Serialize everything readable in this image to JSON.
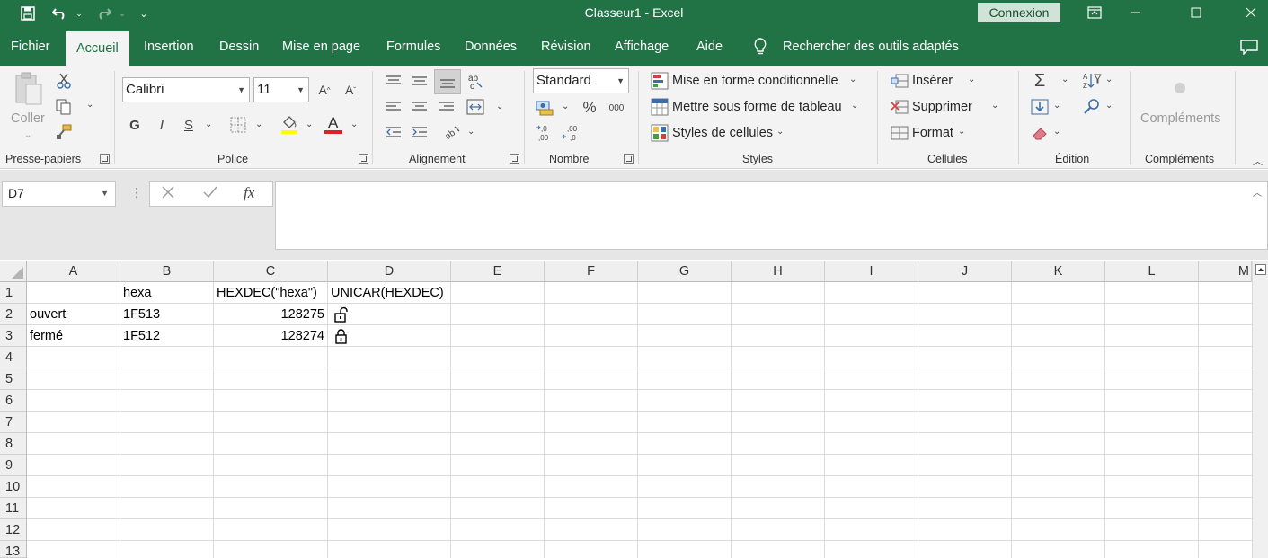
{
  "window": {
    "title": "Classeur1  -  Excel",
    "connexion_label": "Connexion"
  },
  "tabs": [
    {
      "label": "Fichier"
    },
    {
      "label": "Accueil"
    },
    {
      "label": "Insertion"
    },
    {
      "label": "Dessin"
    },
    {
      "label": "Mise en page"
    },
    {
      "label": "Formules"
    },
    {
      "label": "Données"
    },
    {
      "label": "Révision"
    },
    {
      "label": "Affichage"
    },
    {
      "label": "Aide"
    }
  ],
  "active_tab": "Accueil",
  "search": {
    "label": "Rechercher des outils adaptés"
  },
  "ribbon": {
    "clipboard": {
      "paste_label": "Coller",
      "group_label": "Presse-papiers"
    },
    "font": {
      "font_name": "Calibri",
      "font_size": "11",
      "bold": "G",
      "italic": "I",
      "underline": "S",
      "group_label": "Police"
    },
    "alignment": {
      "group_label": "Alignement"
    },
    "number": {
      "format": "Standard",
      "percent": "%",
      "thousands": "000",
      "group_label": "Nombre"
    },
    "styles": {
      "conditional": "Mise en forme conditionnelle",
      "table": "Mettre sous forme de tableau",
      "cell_styles": "Styles de cellules",
      "group_label": "Styles"
    },
    "cells": {
      "insert": "Insérer",
      "delete": "Supprimer",
      "format": "Format",
      "group_label": "Cellules"
    },
    "editing": {
      "group_label": "Édition"
    },
    "addins": {
      "label": "Compléments",
      "group_label": "Compléments"
    }
  },
  "formula_bar": {
    "name_box": "D7",
    "fx": "fx",
    "content": ""
  },
  "sheet": {
    "columns": [
      "A",
      "B",
      "C",
      "D",
      "E",
      "F",
      "G",
      "H",
      "I",
      "J",
      "K",
      "L",
      "M"
    ],
    "rows": [
      "1",
      "2",
      "3",
      "4",
      "5",
      "6",
      "7",
      "8",
      "9",
      "10",
      "11",
      "12",
      "13"
    ],
    "cells": {
      "B1": "hexa",
      "C1": "HEXDEC(\"hexa\")",
      "D1": "UNICAR(HEXDEC)",
      "A2": "ouvert",
      "B2": "1F513",
      "C2": "128275",
      "D2": "🔓",
      "A3": "fermé",
      "B3": "1F512",
      "C3": "128274",
      "D3": "🔒"
    }
  }
}
